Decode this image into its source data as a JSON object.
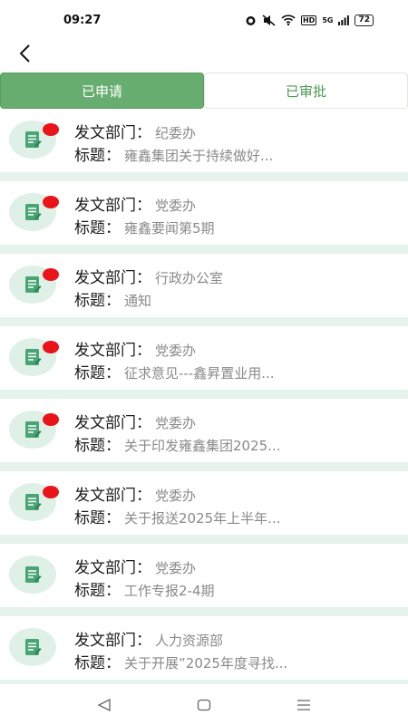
{
  "status": {
    "time": "09:27",
    "battery": "72",
    "network": "5G",
    "hd": "HD"
  },
  "tabs": [
    {
      "label": "已申请",
      "active": true
    },
    {
      "label": "已审批",
      "active": false
    }
  ],
  "labels": {
    "dept": "发文部门：",
    "title": "标题："
  },
  "items": [
    {
      "dept": "纪委办",
      "title": "雍鑫集团关于持续做好...",
      "unread": true
    },
    {
      "dept": "党委办",
      "title": "雍鑫要闻第5期",
      "unread": true
    },
    {
      "dept": "行政办公室",
      "title": "通知",
      "unread": true
    },
    {
      "dept": "党委办",
      "title": "征求意见---鑫昇置业用...",
      "unread": true
    },
    {
      "dept": "党委办",
      "title": "关于印发雍鑫集团2025...",
      "unread": true
    },
    {
      "dept": "党委办",
      "title": "关于报送2025年上半年...",
      "unread": true
    },
    {
      "dept": "党委办",
      "title": "工作专报2-4期",
      "unread": false
    },
    {
      "dept": "人力资源部",
      "title": "关于开展”2025年度寻找...",
      "unread": false
    }
  ],
  "colors": {
    "accent": "#67ad6f",
    "badge": "#e8141a",
    "divider": "#e5f3ec"
  }
}
